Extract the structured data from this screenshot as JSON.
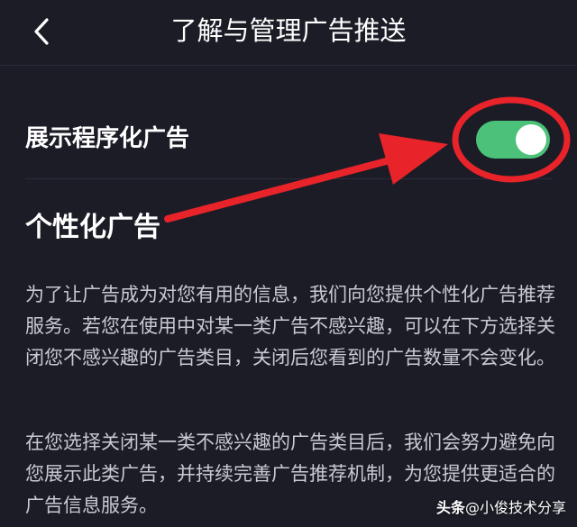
{
  "header": {
    "title": "了解与管理广告推送",
    "back_icon": "chevron-left-icon"
  },
  "setting_row": {
    "label": "展示程序化广告",
    "toggle_on": true,
    "toggle_color": "#4cc17a"
  },
  "section": {
    "title": "个性化广告",
    "paragraph1": "为了让广告成为对您有用的信息，我们向您提供个性化广告推荐服务。若您在使用中对某一类广告不感兴趣，可以在下方选择关闭您不感兴趣的广告类目，关闭后您看到的广告数量不会变化。",
    "paragraph2": "在您选择关闭某一类不感兴趣的广告类目后，我们会努力避免向您展示此类广告，并持续完善广告推荐机制，为您提供更适合的广告信息服务。"
  },
  "annotation": {
    "color": "#e8232a"
  },
  "watermark": {
    "brand": "头条",
    "account": "@小俊技术分享"
  }
}
